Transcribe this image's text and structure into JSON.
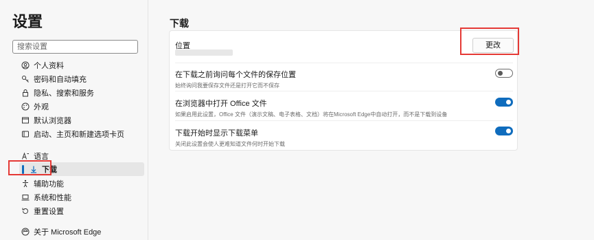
{
  "sidebar": {
    "title": "设置",
    "search_placeholder": "搜索设置",
    "items": [
      {
        "label": "个人资料",
        "icon": "profile-icon"
      },
      {
        "label": "密码和自动填充",
        "icon": "key-icon"
      },
      {
        "label": "隐私、搜索和服务",
        "icon": "lock-icon"
      },
      {
        "label": "外观",
        "icon": "appearance-icon"
      },
      {
        "label": "默认浏览器",
        "icon": "browser-icon"
      },
      {
        "label": "启动、主页和新建选项卡页",
        "icon": "home-icon"
      },
      {
        "label": "语言",
        "icon": "language-icon"
      },
      {
        "label": "下载",
        "icon": "download-icon"
      },
      {
        "label": "辅助功能",
        "icon": "accessibility-icon"
      },
      {
        "label": "系统和性能",
        "icon": "laptop-icon"
      },
      {
        "label": "重置设置",
        "icon": "reset-icon"
      },
      {
        "label": "关于 Microsoft Edge",
        "icon": "edge-icon"
      }
    ],
    "active_item": "下载"
  },
  "main": {
    "title": "下载",
    "location": {
      "label": "位置",
      "change_button": "更改"
    },
    "settings": [
      {
        "label": "在下载之前询问每个文件的保存位置",
        "description": "始终询问我要保存文件还是打开它而不保存",
        "enabled": false
      },
      {
        "label": "在浏览器中打开 Office 文件",
        "description": "如果启用此设置，Office 文件（演示文稿、电子表格、文档）将在Microsoft Edge中自动打开，而不是下载到设备",
        "enabled": true
      },
      {
        "label": "下载开始时显示下载菜单",
        "description": "关闭此设置会使人更难知道文件何时开始下载",
        "enabled": true
      }
    ]
  },
  "colors": {
    "accent": "#0f6cbd",
    "highlight": "#e53935"
  }
}
